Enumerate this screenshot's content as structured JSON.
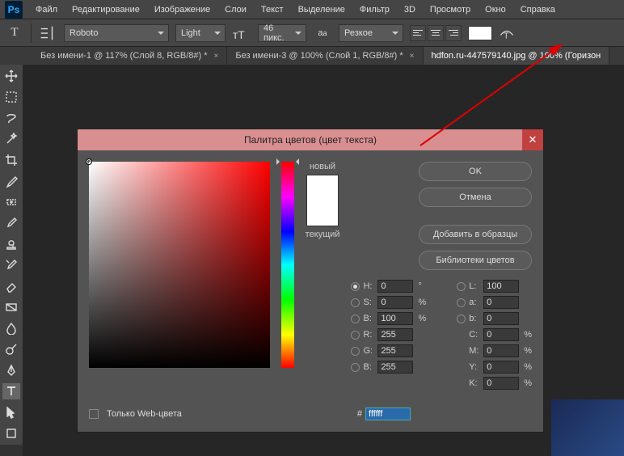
{
  "app": {
    "logo": "Ps"
  },
  "menu": [
    "Файл",
    "Редактирование",
    "Изображение",
    "Слои",
    "Текст",
    "Выделение",
    "Фильтр",
    "3D",
    "Просмотр",
    "Окно",
    "Справка"
  ],
  "options": {
    "font_family": "Roboto",
    "font_weight": "Light",
    "font_size": "46 пикс.",
    "aa": "Резкое"
  },
  "tabs": [
    {
      "label": "Без имени-1 @ 117% (Слой 8, RGB/8#) *",
      "active": false
    },
    {
      "label": "Без имени-3 @ 100% (Слой 1, RGB/8#) *",
      "active": false
    },
    {
      "label": "hdfon.ru-447579140.jpg @ 100% (Горизон",
      "active": true
    }
  ],
  "dialog": {
    "title": "Палитра цветов (цвет текста)",
    "new_label": "новый",
    "current_label": "текущий",
    "ok": "OK",
    "cancel": "Отмена",
    "add_swatch": "Добавить в образцы",
    "color_libs": "Библиотеки цветов",
    "web_only": "Только Web-цвета",
    "hex": "ffffff",
    "hsb": {
      "H": "0",
      "S": "0",
      "B": "100"
    },
    "lab": {
      "L": "100",
      "a": "0",
      "b": "0"
    },
    "rgb": {
      "R": "255",
      "G": "255",
      "B": "255"
    },
    "cmyk": {
      "C": "0",
      "M": "0",
      "Y": "0",
      "K": "0"
    }
  }
}
